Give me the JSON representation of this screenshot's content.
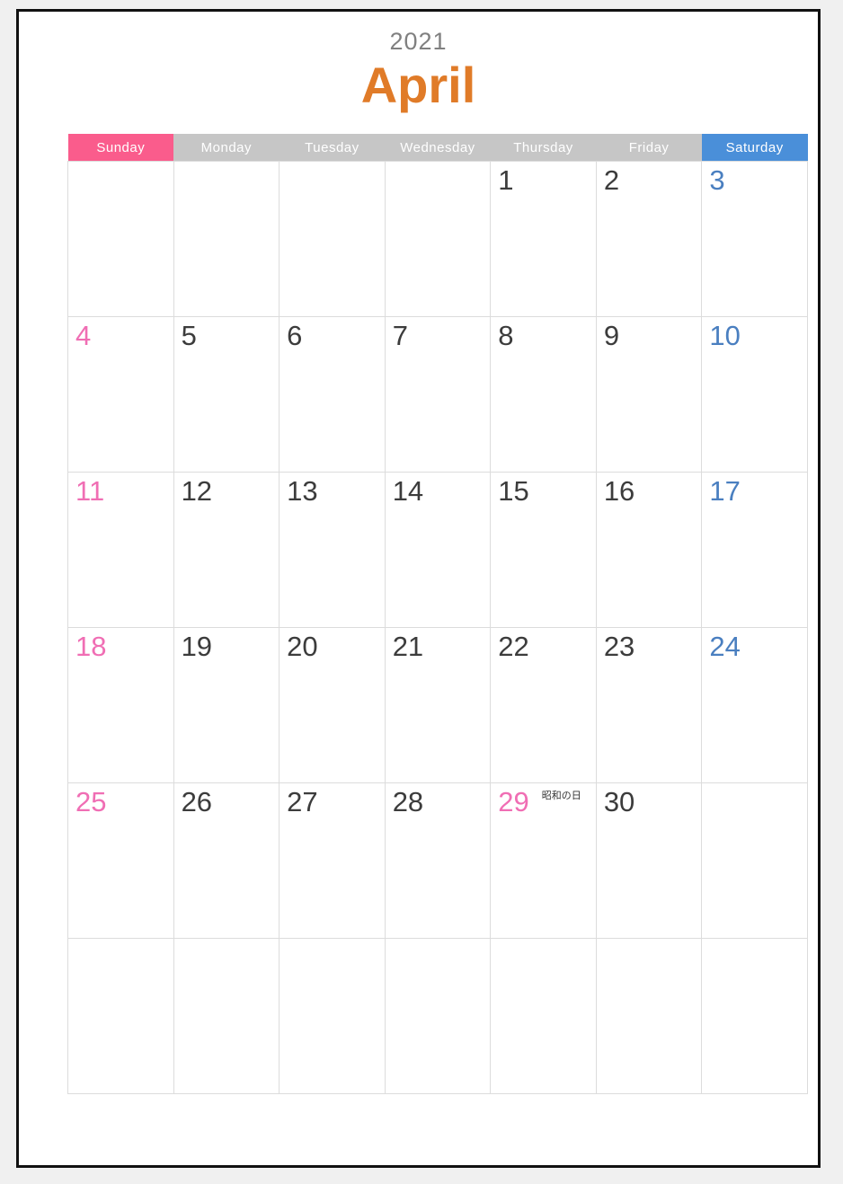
{
  "page": {
    "year": "2021",
    "month": "April"
  },
  "colors": {
    "sunday_header_bg": "#FA5C8C",
    "saturday_header_bg": "#4A8FD9",
    "weekday_header_bg": "#c6c6c6",
    "month_title": "#E07B28",
    "year_title": "#808080",
    "sunday_number": "#F06EB4",
    "saturday_number": "#4A7FC0",
    "weekday_number": "#3c3c3c",
    "grid_line": "#dcdcdc",
    "page_border": "#111111",
    "page_background": "#ffffff",
    "outer_background": "#f0f0f0"
  },
  "weekdays": [
    {
      "label": "Sunday",
      "kind": "sun"
    },
    {
      "label": "Monday",
      "kind": "weekday"
    },
    {
      "label": "Tuesday",
      "kind": "weekday"
    },
    {
      "label": "Wednesday",
      "kind": "weekday"
    },
    {
      "label": "Thursday",
      "kind": "weekday"
    },
    {
      "label": "Friday",
      "kind": "weekday"
    },
    {
      "label": "Saturday",
      "kind": "sat"
    }
  ],
  "weeks": [
    [
      {
        "day": "",
        "kind": "sun",
        "event": ""
      },
      {
        "day": "",
        "kind": "weekday",
        "event": ""
      },
      {
        "day": "",
        "kind": "weekday",
        "event": ""
      },
      {
        "day": "",
        "kind": "weekday",
        "event": ""
      },
      {
        "day": "1",
        "kind": "weekday",
        "event": ""
      },
      {
        "day": "2",
        "kind": "weekday",
        "event": ""
      },
      {
        "day": "3",
        "kind": "sat",
        "event": ""
      }
    ],
    [
      {
        "day": "4",
        "kind": "sun",
        "event": ""
      },
      {
        "day": "5",
        "kind": "weekday",
        "event": ""
      },
      {
        "day": "6",
        "kind": "weekday",
        "event": ""
      },
      {
        "day": "7",
        "kind": "weekday",
        "event": ""
      },
      {
        "day": "8",
        "kind": "weekday",
        "event": ""
      },
      {
        "day": "9",
        "kind": "weekday",
        "event": ""
      },
      {
        "day": "10",
        "kind": "sat",
        "event": ""
      }
    ],
    [
      {
        "day": "11",
        "kind": "sun",
        "event": ""
      },
      {
        "day": "12",
        "kind": "weekday",
        "event": ""
      },
      {
        "day": "13",
        "kind": "weekday",
        "event": ""
      },
      {
        "day": "14",
        "kind": "weekday",
        "event": ""
      },
      {
        "day": "15",
        "kind": "weekday",
        "event": ""
      },
      {
        "day": "16",
        "kind": "weekday",
        "event": ""
      },
      {
        "day": "17",
        "kind": "sat",
        "event": ""
      }
    ],
    [
      {
        "day": "18",
        "kind": "sun",
        "event": ""
      },
      {
        "day": "19",
        "kind": "weekday",
        "event": ""
      },
      {
        "day": "20",
        "kind": "weekday",
        "event": ""
      },
      {
        "day": "21",
        "kind": "weekday",
        "event": ""
      },
      {
        "day": "22",
        "kind": "weekday",
        "event": ""
      },
      {
        "day": "23",
        "kind": "weekday",
        "event": ""
      },
      {
        "day": "24",
        "kind": "sat",
        "event": ""
      }
    ],
    [
      {
        "day": "25",
        "kind": "sun",
        "event": ""
      },
      {
        "day": "26",
        "kind": "weekday",
        "event": ""
      },
      {
        "day": "27",
        "kind": "weekday",
        "event": ""
      },
      {
        "day": "28",
        "kind": "weekday",
        "event": ""
      },
      {
        "day": "29",
        "kind": "holiday",
        "event": "昭和の日"
      },
      {
        "day": "30",
        "kind": "weekday",
        "event": ""
      },
      {
        "day": "",
        "kind": "sat",
        "event": ""
      }
    ],
    [
      {
        "day": "",
        "kind": "sun",
        "event": ""
      },
      {
        "day": "",
        "kind": "weekday",
        "event": ""
      },
      {
        "day": "",
        "kind": "weekday",
        "event": ""
      },
      {
        "day": "",
        "kind": "weekday",
        "event": ""
      },
      {
        "day": "",
        "kind": "weekday",
        "event": ""
      },
      {
        "day": "",
        "kind": "weekday",
        "event": ""
      },
      {
        "day": "",
        "kind": "sat",
        "event": ""
      }
    ]
  ]
}
